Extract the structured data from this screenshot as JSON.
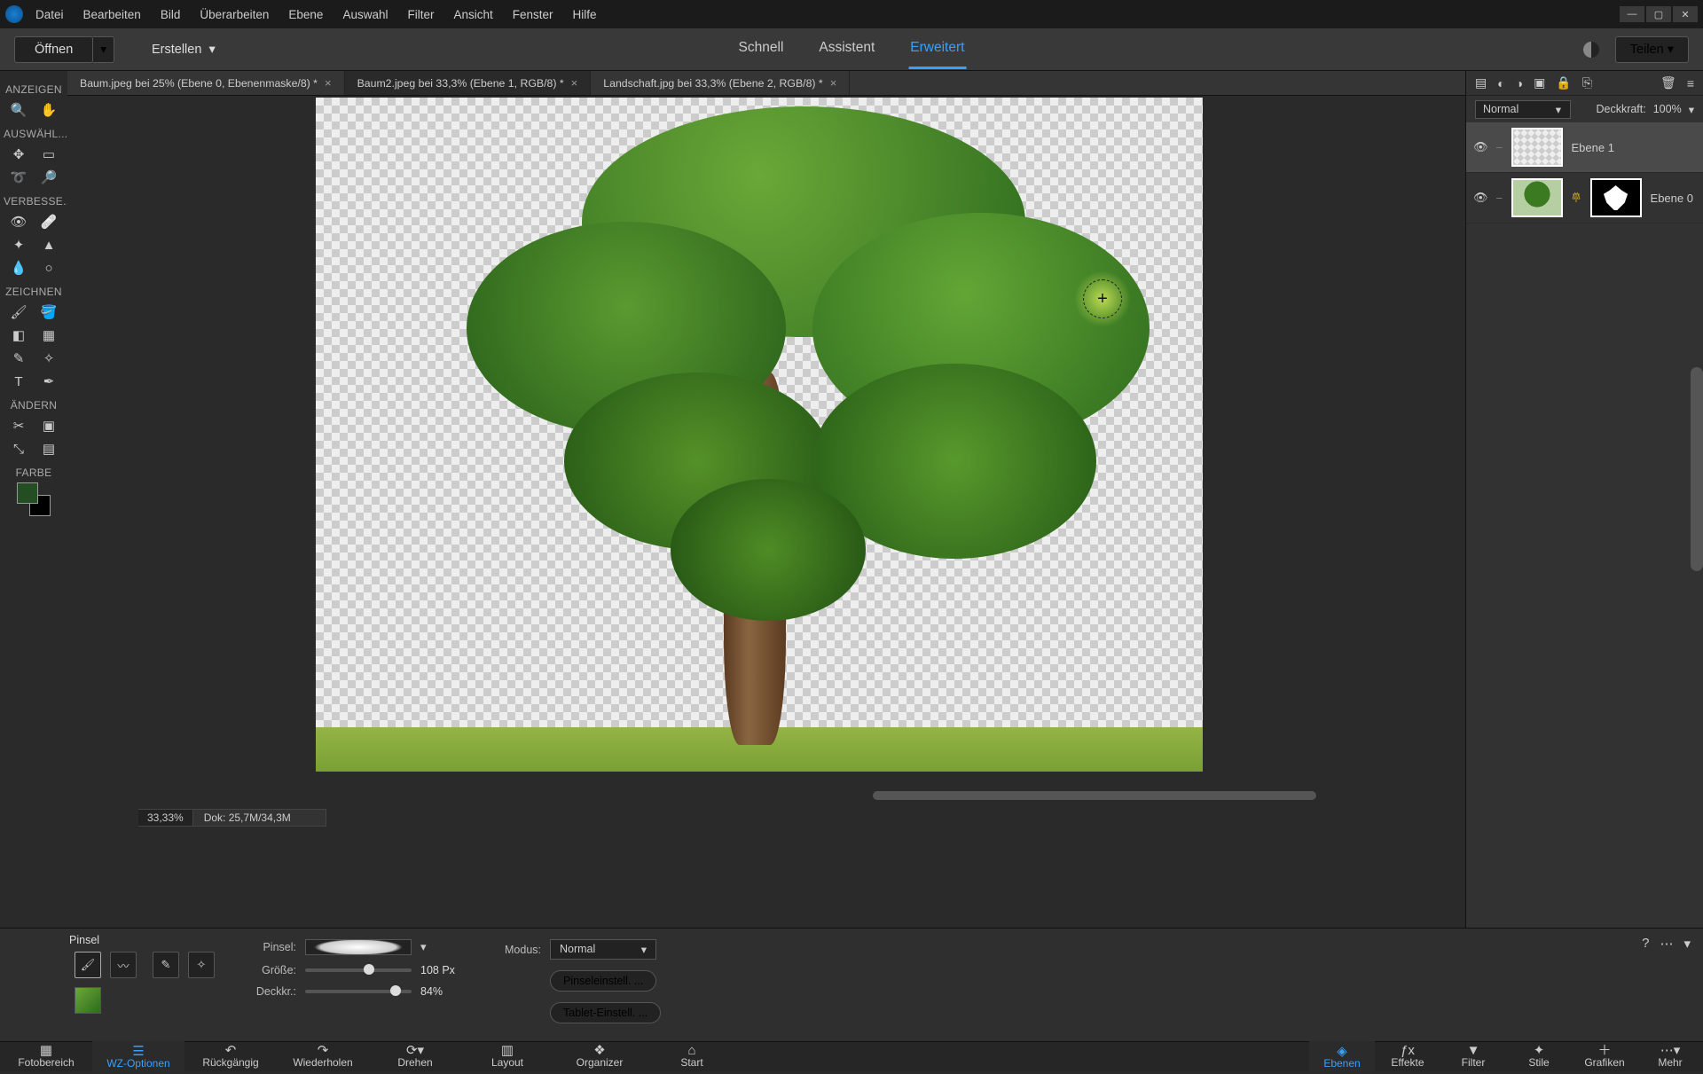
{
  "menu": {
    "datei": "Datei",
    "bearbeiten": "Bearbeiten",
    "bild": "Bild",
    "ueberarbeiten": "Überarbeiten",
    "ebene": "Ebene",
    "auswahl": "Auswahl",
    "filter": "Filter",
    "ansicht": "Ansicht",
    "fenster": "Fenster",
    "hilfe": "Hilfe"
  },
  "topbar": {
    "open": "Öffnen",
    "create": "Erstellen",
    "share": "Teilen"
  },
  "modes": {
    "quick": "Schnell",
    "assist": "Assistent",
    "expert": "Erweitert"
  },
  "tabs": [
    {
      "label": "Baum.jpeg bei 25% (Ebene 0, Ebenenmaske/8) *"
    },
    {
      "label": "Baum2.jpeg bei 33,3% (Ebene 1, RGB/8) *"
    },
    {
      "label": "Landschaft.jpg bei 33,3% (Ebene 2, RGB/8) *"
    }
  ],
  "tool_groups": {
    "anzeigen": "ANZEIGEN",
    "auswaehl": "AUSWÄHL...",
    "verbessern": "VERBESSE...",
    "zeichnen": "ZEICHNEN",
    "aendern": "ÄNDERN",
    "farbe": "FARBE"
  },
  "status": {
    "zoom": "33,33%",
    "dok": "Dok: 25,7M/34,3M"
  },
  "layers_panel": {
    "blend_mode": "Normal",
    "opacity_label": "Deckkraft:",
    "opacity_value": "100%",
    "layers": [
      {
        "name": "Ebene 1"
      },
      {
        "name": "Ebene 0"
      }
    ]
  },
  "options": {
    "title": "Pinsel",
    "brush_label": "Pinsel:",
    "size_label": "Größe:",
    "size_value": "108 Px",
    "opacity_label": "Deckkr.:",
    "opacity_value": "84%",
    "mode_label": "Modus:",
    "mode_value": "Normal",
    "brush_settings": "Pinseleinstell. ...",
    "tablet_settings": "Tablet-Einstell. ..."
  },
  "bottom": {
    "fotobereich": "Fotobereich",
    "wzopt": "WZ-Optionen",
    "undo": "Rückgängig",
    "redo": "Wiederholen",
    "rotate": "Drehen",
    "layout": "Layout",
    "organizer": "Organizer",
    "start": "Start",
    "ebenen": "Ebenen",
    "effekte": "Effekte",
    "filter": "Filter",
    "stile": "Stile",
    "grafiken": "Grafiken",
    "mehr": "Mehr"
  }
}
